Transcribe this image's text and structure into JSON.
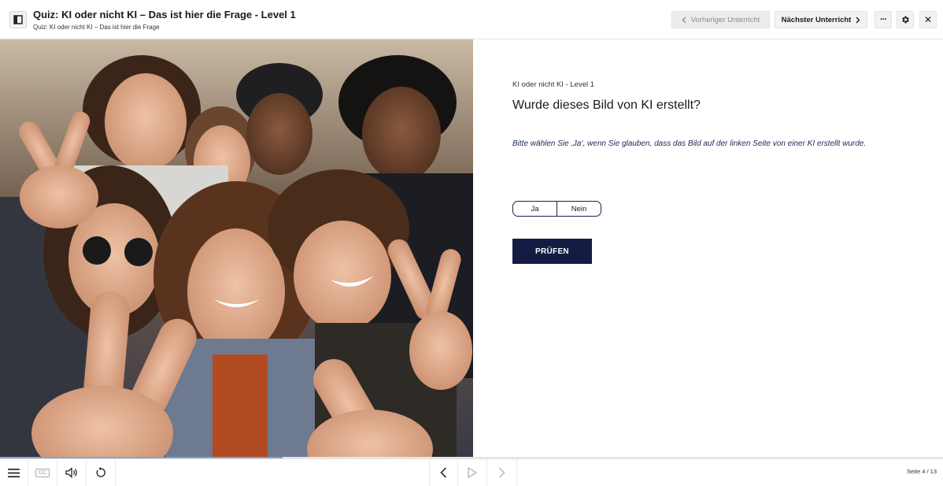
{
  "header": {
    "title": "Quiz: KI oder nicht KI – Das ist hier die Frage - Level 1",
    "subtitle": "Quiz: KI oder nicht KI – Das ist hier die Frage",
    "prev_label": "Vorheriger Unterricht",
    "next_label": "Nächster Unterricht",
    "more_label": "···",
    "close_label": "✕"
  },
  "question": {
    "level": "KI oder nicht KI - Level 1",
    "title": "Wurde dieses Bild von KI erstellt?",
    "instruction": "Bitte wählen Sie ‚Ja‘, wenn Sie glauben, dass das Bild auf der linken Seite von einer KI erstellt wurde.",
    "options": [
      "Ja",
      "Nein"
    ],
    "submit_label": "PRÜFEN"
  },
  "footer": {
    "cc_label": "CC",
    "page_indicator": "Seite 4 / 13",
    "progress": 0.3
  },
  "icons": [
    "sidebar-toggle-icon",
    "chevron-left-icon",
    "chevron-right-icon",
    "gear-icon",
    "menu-icon",
    "audio-icon",
    "replay-icon",
    "play-icon"
  ],
  "colors": {
    "accent": "#141c44",
    "progress": "#8ca0d0"
  }
}
